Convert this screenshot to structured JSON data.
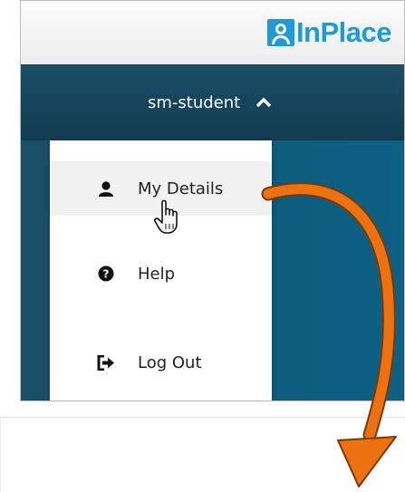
{
  "header": {
    "brand": "InPlace",
    "brand_color": "#1e9bd7",
    "logo_icon": "person-frame-icon"
  },
  "navbar": {
    "username": "sm-student",
    "toggle_icon": "chevron-up-icon",
    "background": "#123c52"
  },
  "user_menu": {
    "items": [
      {
        "label": "My Details",
        "icon": "user-icon",
        "active": true
      },
      {
        "label": "Help",
        "icon": "question-circle-icon",
        "active": false
      },
      {
        "label": "Log Out",
        "icon": "sign-out-icon",
        "active": false
      }
    ]
  },
  "annotation": {
    "arrow_color": "#ec7211",
    "pointer": "hand-pointer-icon"
  }
}
